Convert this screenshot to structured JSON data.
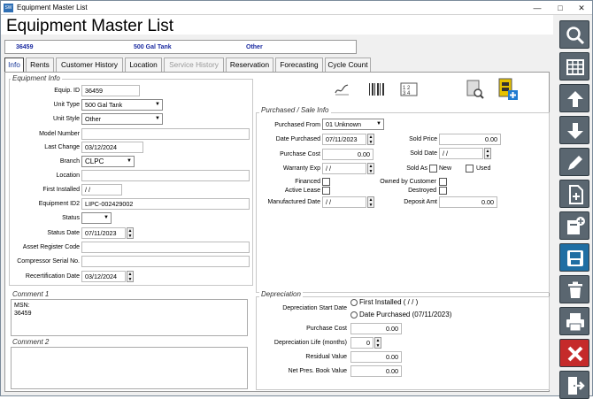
{
  "window": {
    "title": "Equipment Master List"
  },
  "header": {
    "title": "Equipment Master List"
  },
  "infobar": {
    "id": "36459",
    "description": "500 Gal Tank",
    "style": "Other"
  },
  "tabs": [
    {
      "label": "Info"
    },
    {
      "label": "Rents"
    },
    {
      "label": "Customer History"
    },
    {
      "label": "Location"
    },
    {
      "label": "Service History"
    },
    {
      "label": "Reservation"
    },
    {
      "label": "Forecasting"
    },
    {
      "label": "Cycle Count"
    }
  ],
  "equip": {
    "group_title": "Equipment Info",
    "labels": {
      "equip_id": "Equip. ID",
      "unit_type": "Unit Type",
      "unit_style": "Unit Style",
      "model_number": "Model Number",
      "last_change": "Last Change",
      "branch": "Branch",
      "location": "Location",
      "first_installed": "First Installed",
      "equipment_id2": "Equipment ID2",
      "status": "Status",
      "status_date": "Status Date",
      "asset_register_code": "Asset Register Code",
      "compressor_serial": "Compressor Serial No.",
      "recertification_date": "Recertification Date"
    },
    "values": {
      "equip_id": "36459",
      "unit_type": "500 Gal Tank",
      "unit_style": "Other",
      "model_number": "",
      "last_change": "03/12/2024",
      "branch": "CLPC",
      "location": "",
      "first_installed": " / /",
      "equipment_id2": "LIPC-002429002",
      "status": "",
      "status_date": "07/11/2023",
      "asset_register_code": "",
      "compressor_serial": "",
      "recertification_date": "03/12/2024"
    }
  },
  "comments": {
    "comment1_label": "Comment 1",
    "comment1_line1": "MSN:",
    "comment1_line2": "36459",
    "comment2_label": "Comment 2"
  },
  "purchase": {
    "group_title": "Purchased / Sale Info",
    "labels": {
      "purchased_from": "Purchased From",
      "date_purchased": "Date Purchased",
      "purchase_cost": "Purchase Cost",
      "warranty_exp": "Warranty Exp",
      "financed": "Financed",
      "active_lease": "Active Lease",
      "manufactured_date": "Manufactured Date",
      "sold_price": "Sold Price",
      "sold_date": "Sold Date",
      "sold_as": "Sold As",
      "new": "New",
      "used": "Used",
      "owned_by_customer": "Owned by Customer",
      "destroyed": "Destroyed",
      "deposit_amt": "Deposit Amt"
    },
    "values": {
      "purchased_from": "01 Unknown",
      "date_purchased": "07/11/2023",
      "purchase_cost": "0.00",
      "warranty_exp": " / /",
      "manufactured_date": " / /",
      "sold_price": "0.00",
      "sold_date": " / /",
      "deposit_amt": "0.00"
    }
  },
  "depreciation": {
    "group_title": "Depreciation",
    "labels": {
      "start_date": "Depreciation Start Date",
      "purchase_cost": "Purchase Cost",
      "life": "Depreciation Life (months)",
      "residual": "Residual Value",
      "net_book": "Net Pres. Book Value"
    },
    "options": {
      "first_installed": "First Installed ( / / )",
      "date_purchased": "Date Purchased (07/11/2023)"
    },
    "values": {
      "purchase_cost": "0.00",
      "life": "0",
      "residual": "0.00",
      "net_book": "0.00"
    }
  },
  "toolbar_icons": [
    "signature-icon",
    "barcode-icon",
    "numbering-icon",
    "document-search-icon",
    "add-record-icon"
  ],
  "sidebar_icons": [
    "search-icon",
    "grid-icon",
    "arrow-up-icon",
    "arrow-down-icon",
    "edit-icon",
    "new-document-icon",
    "add-copy-icon",
    "save-icon",
    "delete-icon",
    "print-icon",
    "close-icon",
    "exit-icon"
  ],
  "colors": {
    "accent": "#1f6ea3",
    "delete": "#c52a2a",
    "side_button": "#5a6670",
    "info_text": "#1a2aa0"
  }
}
